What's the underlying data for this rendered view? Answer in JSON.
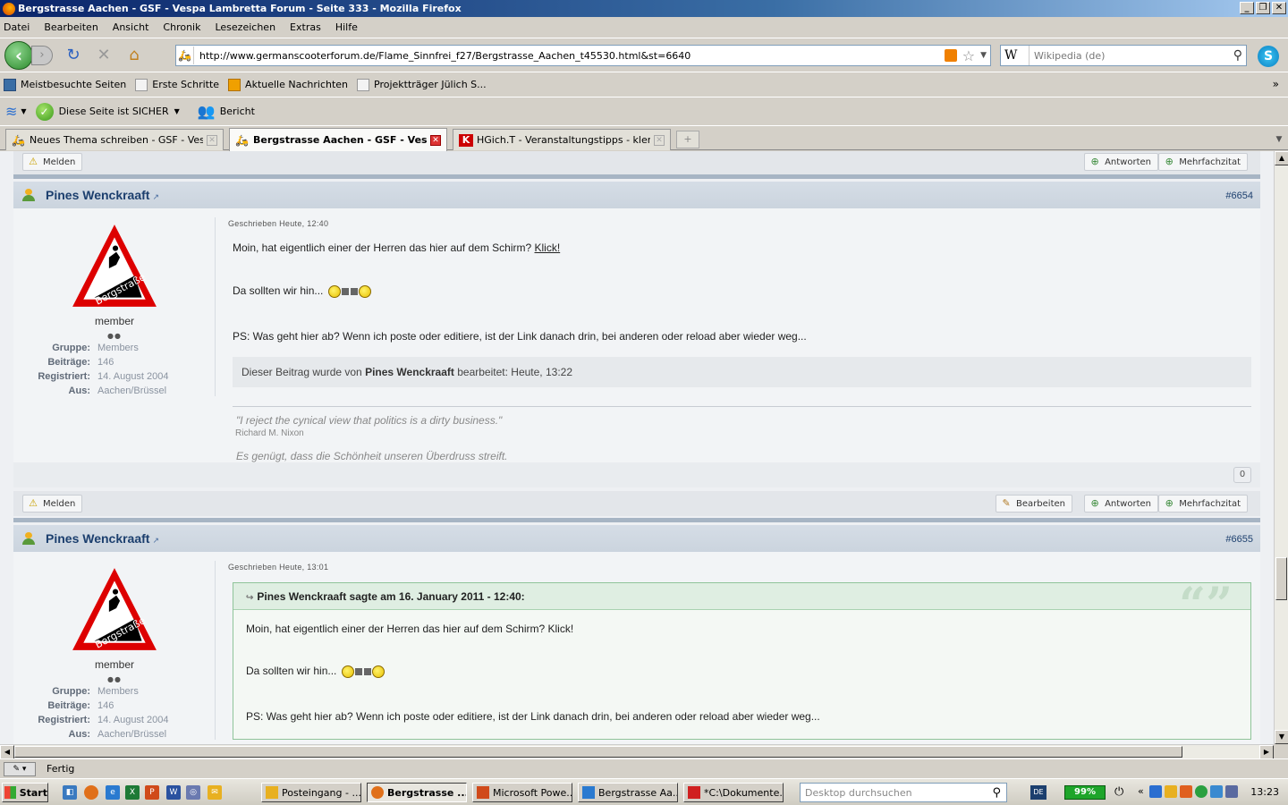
{
  "window": {
    "title": "Bergstrasse Aachen - GSF - Vespa Lambretta Forum - Seite 333 - Mozilla Firefox",
    "buttons": [
      "_",
      "❐",
      "✕"
    ]
  },
  "menu": [
    "Datei",
    "Bearbeiten",
    "Ansicht",
    "Chronik",
    "Lesezeichen",
    "Extras",
    "Hilfe"
  ],
  "nav": {
    "url": "http://www.germanscooterforum.de/Flame_Sinnfrei_f27/Bergstrasse_Aachen_t45530.html&st=6640",
    "search_placeholder": "Wikipedia (de)",
    "search_engine_letter": "W"
  },
  "bookmarks": [
    {
      "label": "Meistbesuchte Seiten",
      "icon": "folder-icon"
    },
    {
      "label": "Erste Schritte",
      "icon": "page-icon"
    },
    {
      "label": "Aktuelle Nachrichten",
      "icon": "rss-icon"
    },
    {
      "label": "Projektträger Jülich S...",
      "icon": "page-icon"
    }
  ],
  "addon": {
    "safe_label": "Diese Seite ist SICHER",
    "report_label": "Bericht"
  },
  "tabs": [
    {
      "label": "Neues Thema schreiben - GSF - Vespa ...",
      "active": false
    },
    {
      "label": "Bergstrasse Aachen - GSF - Vesp...",
      "active": true
    },
    {
      "label": "HGich.T - Veranstaltungstipps - klenkes...",
      "active": false
    }
  ],
  "buttons": {
    "report": "Melden",
    "reply": "Antworten",
    "multiquote": "Mehrfachzitat",
    "edit": "Bearbeiten"
  },
  "posts": [
    {
      "author": "Pines Wenckraaft",
      "number": "#6654",
      "date": "Geschrieben Heute, 12:40",
      "rank": "member",
      "pips": "●●",
      "info": [
        {
          "k": "Gruppe:",
          "v": "Members"
        },
        {
          "k": "Beiträge:",
          "v": "146"
        },
        {
          "k": "Registriert:",
          "v": "14. August 2004"
        },
        {
          "k": "Aus:",
          "v": "Aachen/Brüssel"
        }
      ],
      "line1": "Moin, hat eigentlich einer der Herren das hier auf dem Schirm? ",
      "link": "Klick!",
      "line2": "Da sollten wir hin...",
      "line3": "PS: Was geht hier ab? Wenn ich poste oder editiere, ist der Link danach drin, bei anderen oder reload aber wieder weg...",
      "edit_prefix": "Dieser Beitrag wurde von ",
      "edit_author": "Pines Wenckraaft",
      "edit_suffix": " bearbeitet: Heute, 13:22",
      "sig_quote": "\"I reject the cynical view that politics is a dirty business.\"",
      "sig_author": "Richard M. Nixon",
      "sig_line": "Es genügt, dass die Schönheit unseren Überdruss streift.",
      "rep": "0"
    },
    {
      "author": "Pines Wenckraaft",
      "number": "#6655",
      "date": "Geschrieben Heute, 13:01",
      "rank": "member",
      "pips": "●●",
      "info": [
        {
          "k": "Gruppe:",
          "v": "Members"
        },
        {
          "k": "Beiträge:",
          "v": "146"
        },
        {
          "k": "Registriert:",
          "v": "14. August 2004"
        },
        {
          "k": "Aus:",
          "v": "Aachen/Brüssel"
        }
      ],
      "quote_header": "Pines Wenckraaft sagte am 16. January 2011 - 12:40:",
      "quote_line1": "Moin, hat eigentlich einer der Herren das hier auf dem Schirm? Klick!",
      "quote_line2": "Da sollten wir hin...",
      "quote_line3": "PS: Was geht hier ab? Wenn ich poste oder editiere, ist der Link danach drin, bei anderen oder reload aber wieder weg..."
    }
  ],
  "avatar_text": "Bergstraße",
  "status": "Fertig",
  "taskbar": {
    "start": "Start",
    "tasks": [
      {
        "label": "Posteingang - ...",
        "active": false
      },
      {
        "label": "Bergstrasse ...",
        "active": true
      },
      {
        "label": "Microsoft Powe...",
        "active": false
      },
      {
        "label": "Bergstrasse Aa...",
        "active": false
      },
      {
        "label": "*C:\\Dokumente...",
        "active": false
      }
    ],
    "desktop_search": "Desktop durchsuchen",
    "lang": "DE",
    "battery": "99%",
    "clock": "13:23",
    "tray_chevron": "«"
  },
  "colors": {
    "accent": "#1c3f6e",
    "quote_border": "#8fc49a",
    "quote_header_bg": "#dfeee2"
  }
}
